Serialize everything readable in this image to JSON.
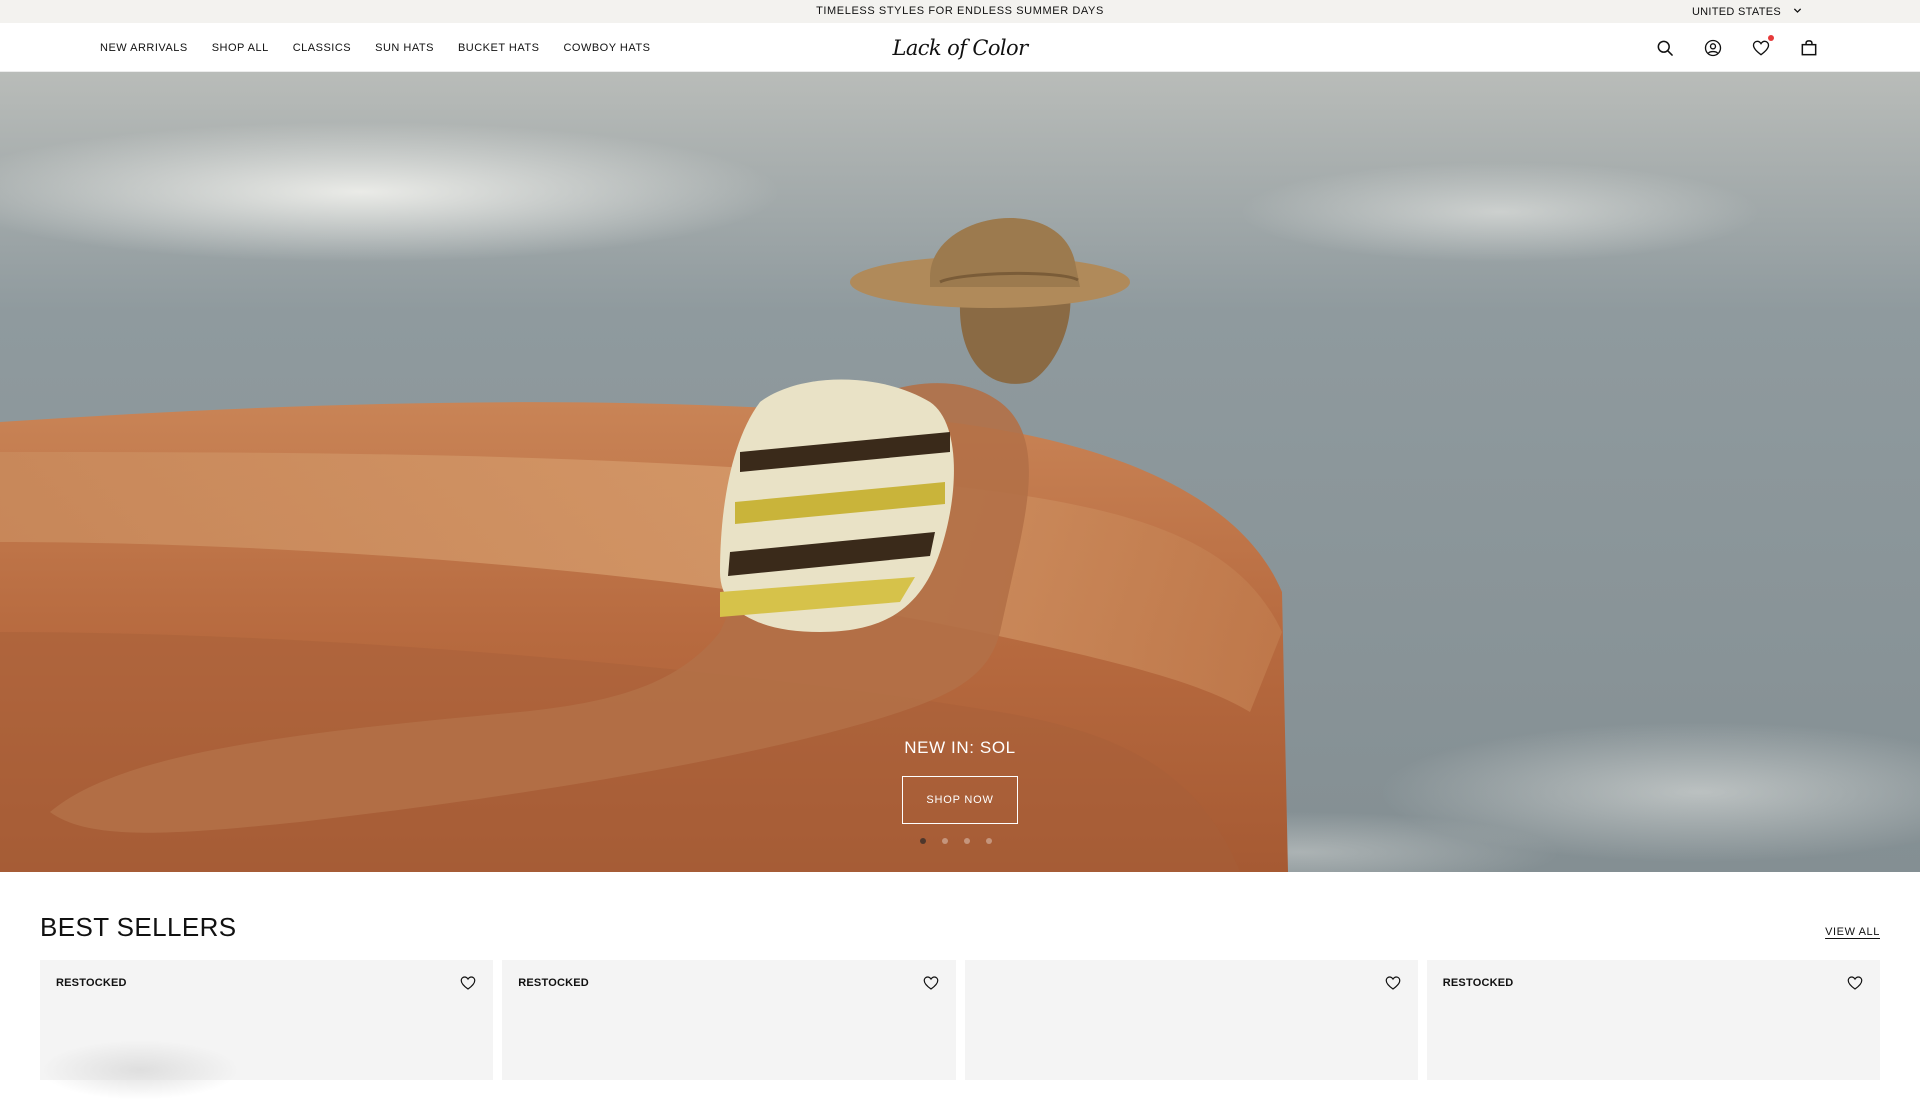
{
  "announcement": {
    "text": "TIMELESS STYLES FOR ENDLESS SUMMER DAYS"
  },
  "country": {
    "label": "UNITED STATES",
    "icon": "chevron-down-icon"
  },
  "nav": {
    "items": [
      {
        "label": "NEW ARRIVALS"
      },
      {
        "label": "SHOP ALL"
      },
      {
        "label": "CLASSICS"
      },
      {
        "label": "SUN HATS"
      },
      {
        "label": "BUCKET HATS"
      },
      {
        "label": "COWBOY HATS"
      }
    ]
  },
  "brand": {
    "logo_text": "Lack of Color"
  },
  "header_icons": {
    "search": "search-icon",
    "account": "account-icon",
    "wishlist": "heart-icon",
    "cart": "bag-icon",
    "wishlist_badge_color": "#e63a3a"
  },
  "hero": {
    "title": "NEW IN: SOL",
    "cta_label": "SHOP NOW",
    "slides_total": 4,
    "active_slide": 1
  },
  "best_sellers": {
    "title": "BEST SELLERS",
    "view_all_label": "VIEW ALL",
    "products": [
      {
        "badge": "RESTOCKED"
      },
      {
        "badge": "RESTOCKED"
      },
      {
        "badge": ""
      },
      {
        "badge": "RESTOCKED"
      }
    ]
  }
}
